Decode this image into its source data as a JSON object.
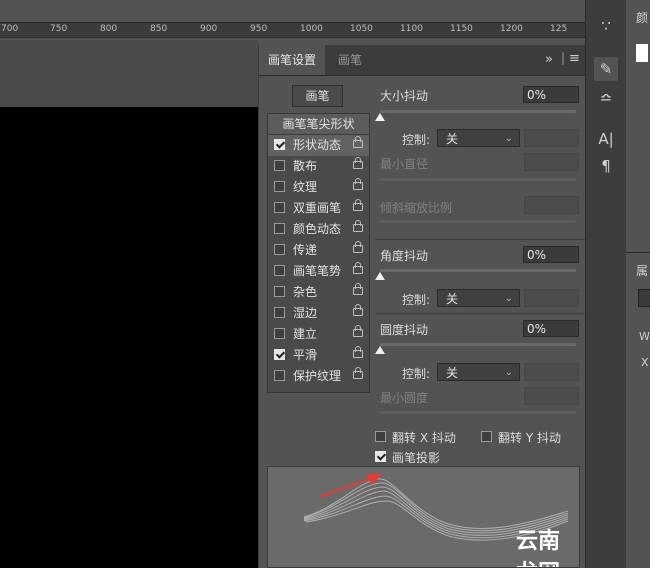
{
  "ruler": {
    "ticks": [
      "700",
      "750",
      "800",
      "850",
      "900",
      "950",
      "1000",
      "1050",
      "1100",
      "1150",
      "1200",
      "125"
    ]
  },
  "panel": {
    "tabs": [
      "画笔设置",
      "画笔"
    ],
    "menu_icon": "panel-menu-icon",
    "collapse_icon": "double-chevron-icon",
    "brush_button": "画笔",
    "list_header": "画笔笔尖形状",
    "items": [
      {
        "label": "形状动态",
        "checked": true
      },
      {
        "label": "散布",
        "checked": false
      },
      {
        "label": "纹理",
        "checked": false
      },
      {
        "label": "双重画笔",
        "checked": false
      },
      {
        "label": "颜色动态",
        "checked": false
      },
      {
        "label": "传递",
        "checked": false
      },
      {
        "label": "画笔笔势",
        "checked": false
      },
      {
        "label": "杂色",
        "checked": false
      },
      {
        "label": "湿边",
        "checked": false
      },
      {
        "label": "建立",
        "checked": false
      },
      {
        "label": "平滑",
        "checked": true
      },
      {
        "label": "保护纹理",
        "checked": false
      }
    ],
    "size_jitter": {
      "label": "大小抖动",
      "value": "0%"
    },
    "control1": {
      "label": "控制:",
      "value": "关"
    },
    "min_diameter": "最小直径",
    "tilt_scale": "倾斜缩放比例",
    "angle_jitter": {
      "label": "角度抖动",
      "value": "0%"
    },
    "control2": {
      "label": "控制:",
      "value": "关"
    },
    "roundness_jitter": {
      "label": "圆度抖动",
      "value": "0%"
    },
    "control3": {
      "label": "控制:",
      "value": "关"
    },
    "min_roundness": "最小圆度",
    "flip_x": {
      "label": "翻转 X 抖动",
      "checked": false
    },
    "flip_y": {
      "label": "翻转 Y 抖动",
      "checked": false
    },
    "brush_projection": {
      "label": "画笔投影",
      "checked": true
    }
  },
  "dock": {
    "icons": [
      "brush-preset-icon",
      "brush-settings-icon",
      "tool-settings-icon",
      "character-icon",
      "paragraph-icon"
    ],
    "letters": [
      "A|",
      "¶"
    ]
  },
  "far_right": {
    "label1": "颜",
    "label2": "属",
    "label3": "W",
    "label4": "X"
  },
  "watermark": "云南龙网",
  "colors": {
    "accent": "#e03c3c",
    "panel": "#535353",
    "canvas": "#000000"
  }
}
